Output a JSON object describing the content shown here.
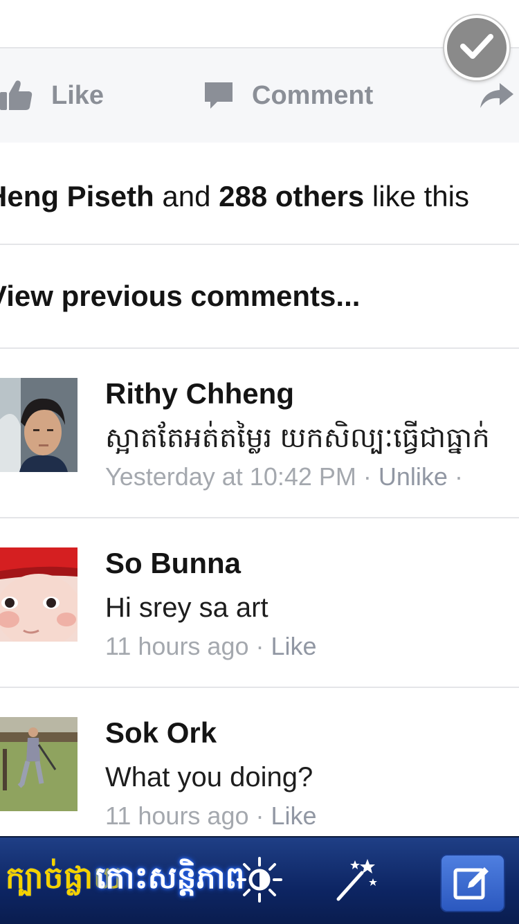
{
  "post_actions": {
    "like_label": "Like",
    "comment_label": "Comment"
  },
  "likes_summary": {
    "name": "Heng Piseth",
    "connector": " and ",
    "others": "288 others",
    "suffix": " like this"
  },
  "view_previous_label": "View previous comments...",
  "comments": [
    {
      "name": "Rithy Chheng",
      "text": "ស្អាតតែអត់តម្លៃរ យកសិល្បៈធ្វើជាធ្នាក់",
      "time": "Yesterday at 10:42 PM",
      "action": "Unlike"
    },
    {
      "name": "So Bunna",
      "text": "Hi srey sa art",
      "time": "11 hours ago",
      "action": "Like"
    },
    {
      "name": "Sok Ork",
      "text": "What you doing?",
      "time": "11 hours ago",
      "action": "Like"
    }
  ],
  "bottom_bar": {
    "brand_text": "ក្បាច់ផ្លាយ",
    "brand_logo_text": "កោះសន្តិភាព"
  },
  "colors": {
    "bar_background": "#0d2563",
    "action_gray": "#8b8f97",
    "meta_gray": "#a4a8ae",
    "brand_yellow": "#f4d200"
  },
  "icons": [
    "thumbs-up-icon",
    "comment-bubble-icon",
    "share-arrow-icon",
    "checkmark-icon",
    "brightness-icon",
    "magic-wand-icon",
    "edit-icon"
  ]
}
